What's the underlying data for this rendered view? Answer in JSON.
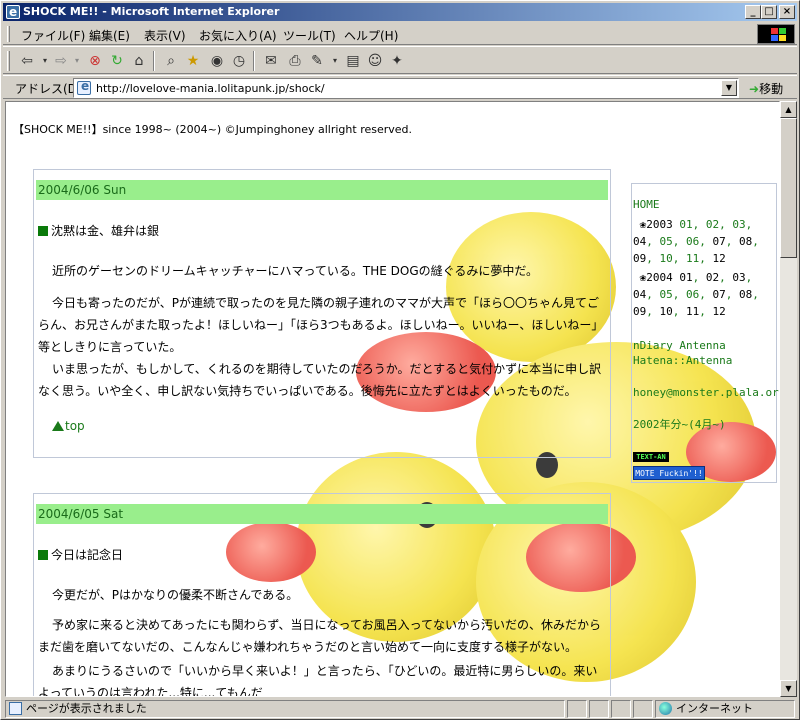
{
  "window": {
    "title": "SHOCK ME!! - Microsoft Internet Explorer"
  },
  "menu": [
    "ファイル(F)",
    "編集(E)",
    "表示(V)",
    "お気に入り(A)",
    "ツール(T)",
    "ヘルプ(H)"
  ],
  "address": {
    "label": "アドレス(D)",
    "url": "http://lovelove-mania.lolitapunk.jp/shock/",
    "go_label": "移動"
  },
  "page": {
    "copyright": "【SHOCK ME!!】since 1998~ (2004~) ©Jumpinghoney allright reserved.",
    "posts": [
      {
        "date": "2004/6/06 Sun",
        "title": "沈黙は金、雄弁は銀",
        "paragraphs": [
          "近所のゲーセンのドリームキャッチャーにハマっている。THE DOGの縫ぐるみに夢中だ。",
          "今日も寄ったのだが、Pが連続で取ったのを見た隣の親子連れのママが大声で「ほら〇〇ちゃん見てごらん、お兄さんがまた取ったよ！ほしいねー」「ほら3つもあるよ。ほしいねー。いいねー、ほしいねー」等としきりに言っていた。",
          "いま思ったが、もしかして、くれるのを期待していたのだろうか。だとすると気付かずに本当に申し訳なく思う。いや全く、申し訳ない気持ちでいっぱいである。後悔先に立たずとはよくいったものだ。"
        ],
        "top_link": "top"
      },
      {
        "date": "2004/6/05 Sat",
        "title": "今日は記念日",
        "paragraphs": [
          "今更だが、Pはかなりの優柔不断さんである。",
          "予め家に来ると決めてあったにも関わらず、当日になってお風呂入ってないから汚いだの、休みだからまだ歯を磨いてないだの、こんなんじゃ嫌われちゃうだのと言い始めて一向に支度する様子がない。",
          "あまりにうるさいので「いいから早く来いよ！」と言ったら、「ひどいの。最近特に男らしいの。来いよっていうのは言われた...特に...てもんだ"
        ]
      }
    ]
  },
  "sidebar": {
    "home": "HOME",
    "y2003": {
      "year": "2003",
      "months": [
        "01",
        "02",
        "03",
        "04",
        "05",
        "06",
        "07",
        "08",
        "09",
        "10",
        "11",
        "12"
      ]
    },
    "y2004": {
      "year": "2004",
      "months": [
        "01",
        "02",
        "03",
        "04",
        "05",
        "06",
        "07",
        "08",
        "09",
        "10",
        "11",
        "12"
      ]
    },
    "antenna1": "nDiary Antenna",
    "antenna2": "Hatena::Antenna",
    "email": "honey@monster.plala.or.jp",
    "archive": "2002年分~(4月~)",
    "badge1": "TEXT-AN",
    "badge2": "MOTE Fuckin'!!"
  },
  "status": {
    "text": "ページが表示されました",
    "zone": "インターネット"
  }
}
